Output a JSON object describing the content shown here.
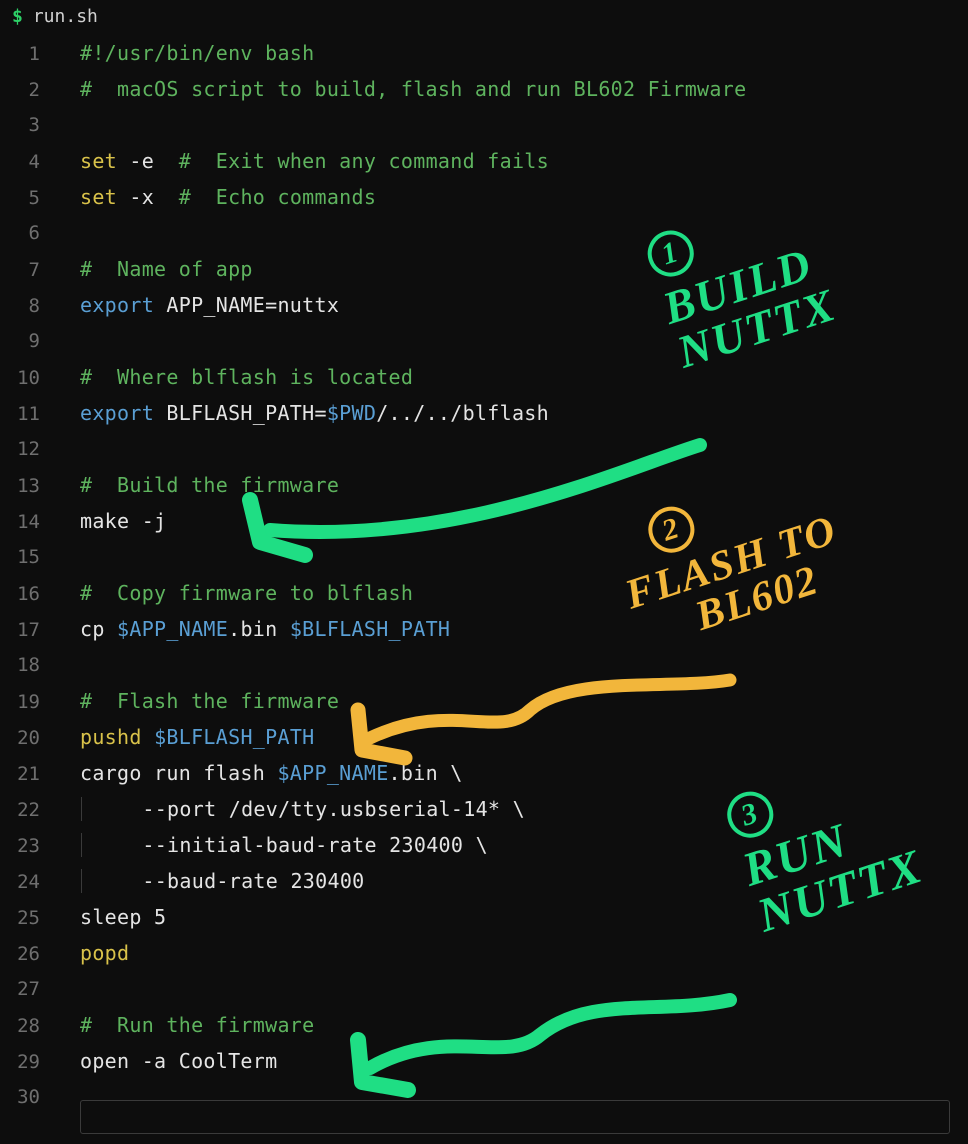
{
  "titlebar": {
    "prompt": "$",
    "filename": "run.sh"
  },
  "lines": [
    {
      "n": 1,
      "tokens": [
        [
          "c-comment",
          "#!/usr/bin/env bash"
        ]
      ]
    },
    {
      "n": 2,
      "tokens": [
        [
          "c-comment",
          "#  macOS script to build, flash and run BL602 Firmware"
        ]
      ]
    },
    {
      "n": 3,
      "tokens": []
    },
    {
      "n": 4,
      "tokens": [
        [
          "c-keyword",
          "set"
        ],
        [
          "c-plain",
          " -e  "
        ],
        [
          "c-comment",
          "#  Exit when any command fails"
        ]
      ]
    },
    {
      "n": 5,
      "tokens": [
        [
          "c-keyword",
          "set"
        ],
        [
          "c-plain",
          " -x  "
        ],
        [
          "c-comment",
          "#  Echo commands"
        ]
      ]
    },
    {
      "n": 6,
      "tokens": []
    },
    {
      "n": 7,
      "tokens": [
        [
          "c-comment",
          "#  Name of app"
        ]
      ]
    },
    {
      "n": 8,
      "tokens": [
        [
          "c-builtin",
          "export"
        ],
        [
          "c-plain",
          " APP_NAME=nuttx"
        ]
      ]
    },
    {
      "n": 9,
      "tokens": []
    },
    {
      "n": 10,
      "tokens": [
        [
          "c-comment",
          "#  Where blflash is located"
        ]
      ]
    },
    {
      "n": 11,
      "tokens": [
        [
          "c-builtin",
          "export"
        ],
        [
          "c-plain",
          " BLFLASH_PATH="
        ],
        [
          "c-var",
          "$PWD"
        ],
        [
          "c-plain",
          "/../../blflash"
        ]
      ]
    },
    {
      "n": 12,
      "tokens": []
    },
    {
      "n": 13,
      "tokens": [
        [
          "c-comment",
          "#  Build the firmware"
        ]
      ]
    },
    {
      "n": 14,
      "tokens": [
        [
          "c-plain",
          "make -j"
        ]
      ]
    },
    {
      "n": 15,
      "tokens": []
    },
    {
      "n": 16,
      "tokens": [
        [
          "c-comment",
          "#  Copy firmware to blflash"
        ]
      ]
    },
    {
      "n": 17,
      "tokens": [
        [
          "c-plain",
          "cp "
        ],
        [
          "c-var",
          "$APP_NAME"
        ],
        [
          "c-plain",
          ".bin "
        ],
        [
          "c-var",
          "$BLFLASH_PATH"
        ]
      ]
    },
    {
      "n": 18,
      "tokens": []
    },
    {
      "n": 19,
      "tokens": [
        [
          "c-comment",
          "#  Flash the firmware"
        ]
      ]
    },
    {
      "n": 20,
      "tokens": [
        [
          "c-cmd",
          "pushd"
        ],
        [
          "c-plain",
          " "
        ],
        [
          "c-var",
          "$BLFLASH_PATH"
        ]
      ]
    },
    {
      "n": 21,
      "tokens": [
        [
          "c-plain",
          "cargo run flash "
        ],
        [
          "c-var",
          "$APP_NAME"
        ],
        [
          "c-plain",
          ".bin \\"
        ]
      ]
    },
    {
      "n": 22,
      "indent": true,
      "tokens": [
        [
          "c-plain",
          "    --port /dev/tty.usbserial-14* \\"
        ]
      ]
    },
    {
      "n": 23,
      "indent": true,
      "tokens": [
        [
          "c-plain",
          "    --initial-baud-rate 230400 \\"
        ]
      ]
    },
    {
      "n": 24,
      "indent": true,
      "tokens": [
        [
          "c-plain",
          "    --baud-rate 230400"
        ]
      ]
    },
    {
      "n": 25,
      "tokens": [
        [
          "c-plain",
          "sleep 5"
        ]
      ]
    },
    {
      "n": 26,
      "tokens": [
        [
          "c-cmd",
          "popd"
        ]
      ]
    },
    {
      "n": 27,
      "tokens": []
    },
    {
      "n": 28,
      "tokens": [
        [
          "c-comment",
          "#  Run the firmware"
        ]
      ]
    },
    {
      "n": 29,
      "tokens": [
        [
          "c-plain",
          "open -a CoolTerm"
        ]
      ]
    },
    {
      "n": 30,
      "tokens": []
    }
  ],
  "annotations": {
    "a1": {
      "num": "1",
      "text1": "BUILD",
      "text2": "NUTTX"
    },
    "a2": {
      "num": "2",
      "text1": "FLASH TO",
      "text2": "BL602"
    },
    "a3": {
      "num": "3",
      "text1": "RUN",
      "text2": "NUTTX"
    }
  }
}
